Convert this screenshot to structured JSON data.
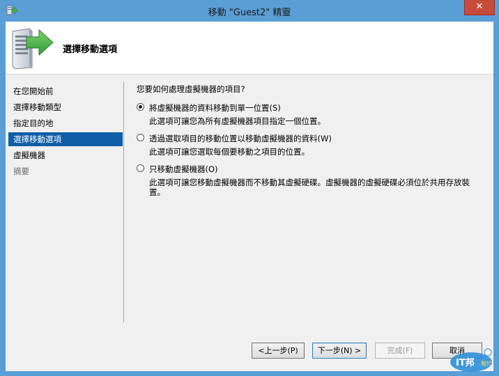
{
  "window": {
    "title": "移動 \"Guest2\" 精靈",
    "close_glyph": "✕"
  },
  "header": {
    "title": "選擇移動選項"
  },
  "nav": {
    "items": [
      {
        "label": "在您開始前",
        "state": "normal"
      },
      {
        "label": "選擇移動類型",
        "state": "normal"
      },
      {
        "label": "指定目的地",
        "state": "normal"
      },
      {
        "label": "選擇移動選項",
        "state": "active"
      },
      {
        "label": "虛擬機器",
        "state": "normal"
      },
      {
        "label": "摘要",
        "state": "disabled"
      }
    ]
  },
  "content": {
    "question": "您要如何處理虛擬機器的項目?",
    "options": [
      {
        "label": "將虛擬機器的資料移動到單一位置(S)",
        "description": "此選項可讓您為所有虛擬機器項目指定一個位置。",
        "checked": true
      },
      {
        "label": "透過選取項目的移動位置以移動虛擬機器的資料(W)",
        "description": "此選項可讓您選取每個要移動之項目的位置。",
        "checked": false
      },
      {
        "label": "只移動虛擬機器(O)",
        "description": "此選項可讓您移動虛擬機器而不移動其虛擬硬碟。虛擬機器的虛擬硬碟必須位於共用存放裝置。",
        "checked": false
      }
    ]
  },
  "footer": {
    "prev": "<上一步(P)",
    "next": "下一步(N) >",
    "finish": "完成(F)",
    "cancel": "取消"
  },
  "watermark": {
    "text": "IT邦",
    "sub": "幫忙"
  },
  "colors": {
    "frame": "#5a9ed6",
    "active_nav": "#0f5fa8",
    "close": "#c74b3a"
  }
}
